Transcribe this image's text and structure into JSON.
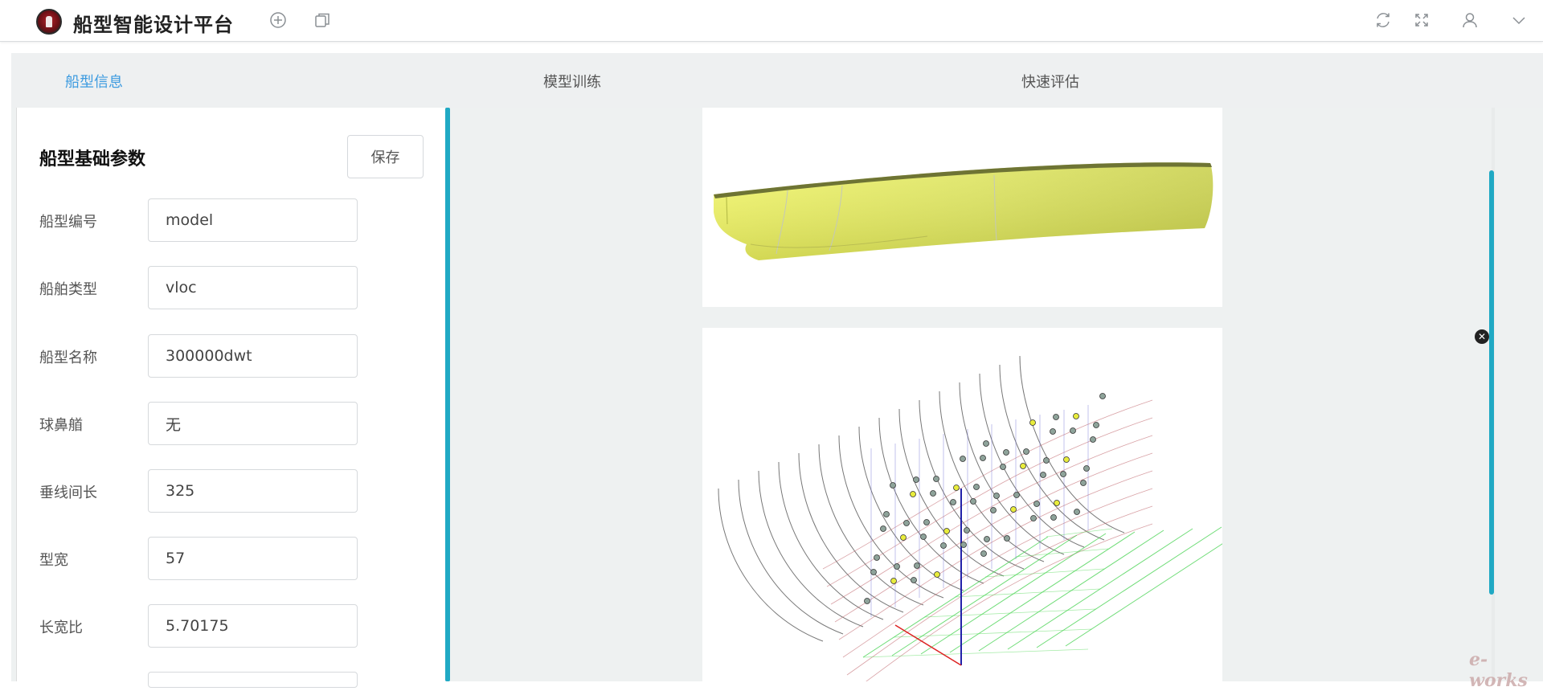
{
  "header": {
    "title": "船型智能设计平台",
    "icons": [
      "add-circle-icon",
      "copy-icon",
      "refresh-icon",
      "fullscreen-icon",
      "user-icon",
      "chevron-down-icon"
    ]
  },
  "tabs": [
    {
      "label": "船型信息",
      "active": true
    },
    {
      "label": "模型训练",
      "active": false
    },
    {
      "label": "快速评估",
      "active": false
    }
  ],
  "panel": {
    "title": "船型基础参数",
    "save_label": "保存",
    "fields": [
      {
        "label": "船型编号",
        "value": "model"
      },
      {
        "label": "船舶类型",
        "value": "vloc"
      },
      {
        "label": "船型名称",
        "value": "300000dwt"
      },
      {
        "label": "球鼻艏",
        "value": "无"
      },
      {
        "label": "垂线间长",
        "value": "325"
      },
      {
        "label": "型宽",
        "value": "57"
      },
      {
        "label": "长宽比",
        "value": "5.70175"
      }
    ]
  },
  "watermark": "e-works",
  "colors": {
    "accent": "#3d9be0",
    "scrollbar": "#20a9c4",
    "hull": "#e6ef5c"
  }
}
